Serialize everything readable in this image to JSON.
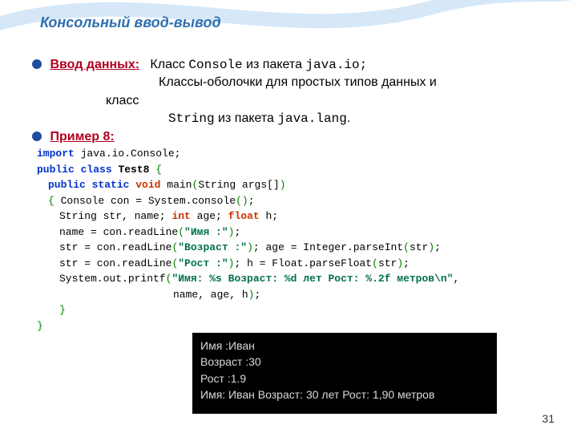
{
  "header": {
    "title": "Консольный ввод-вывод"
  },
  "intro": {
    "input_label": "Ввод данных:",
    "klass_text": "Класс ",
    "console": "Console",
    "from_pkg": " из пакета ",
    "pkg1": "java.io",
    "semi": ";",
    "wrap_line": "Классы-оболочки для простых типов данных и",
    "klass_word": "класс",
    "string": "String",
    "from_pkg2": " из пакета ",
    "pkg2": "java.lang",
    "dot": "."
  },
  "example": {
    "label": "Пример 8:"
  },
  "code": {
    "l1": {
      "kw": "import",
      "rest": " java.io.Console;"
    },
    "l2": {
      "kw1": "public",
      "kw2": "class",
      "cls": "Test8",
      "br": "{"
    },
    "l3": {
      "kw1": "public",
      "kw2": "static",
      "ty": "void",
      "name": "main",
      "paren_o": "(",
      "arg": "String args[]",
      "paren_c": ")"
    },
    "l4": {
      "br_o": "{",
      "txt": " Console con = System.console",
      "paren_o": "(",
      "paren_c": ")",
      "semi": ";"
    },
    "l5": {
      "p1": "String str, name;  ",
      "ty1": "int",
      "p2": " age;  ",
      "ty2": "float",
      "p3": " h;"
    },
    "l6": {
      "p1": "name = con.readLine",
      "paren_o": "(",
      "sl": "\"Имя :\"",
      "paren_c": ")",
      "semi": ";"
    },
    "l7": {
      "p1": "str = con.readLine",
      "paren_o": "(",
      "sl": "\"Возраст :\"",
      "paren_c": ")",
      "p2": "; age = Integer.parseInt",
      "paren_o2": "(",
      "p3": "str",
      "paren_c2": ")",
      "semi": ";"
    },
    "l8": {
      "p1": "str = con.readLine",
      "paren_o": "(",
      "sl": "\"Рост :\"",
      "paren_c": ")",
      "p2": "; h = Float.parseFloat",
      "paren_o2": "(",
      "p3": "str",
      "paren_c2": ")",
      "semi": ";"
    },
    "l9": {
      "p1": "System.out.printf",
      "paren_o": "(",
      "sl": "\"Имя: %s Возраст: %d лет Рост: %.2f метров\\n\"",
      "comma": ","
    },
    "l10": {
      "p1": "name, age, h",
      "paren_c": ")",
      "semi": ";"
    },
    "l11": {
      "br_c": "}"
    },
    "l12": {
      "br_c": "}"
    }
  },
  "console": {
    "l1": "Имя :Иван",
    "l2": "Возраст :30",
    "l3": "Рост :1.9",
    "l4": "Имя: Иван Возраст: 30 лет Рост: 1,90 метров",
    "l5": " "
  },
  "page": {
    "num": "31"
  }
}
